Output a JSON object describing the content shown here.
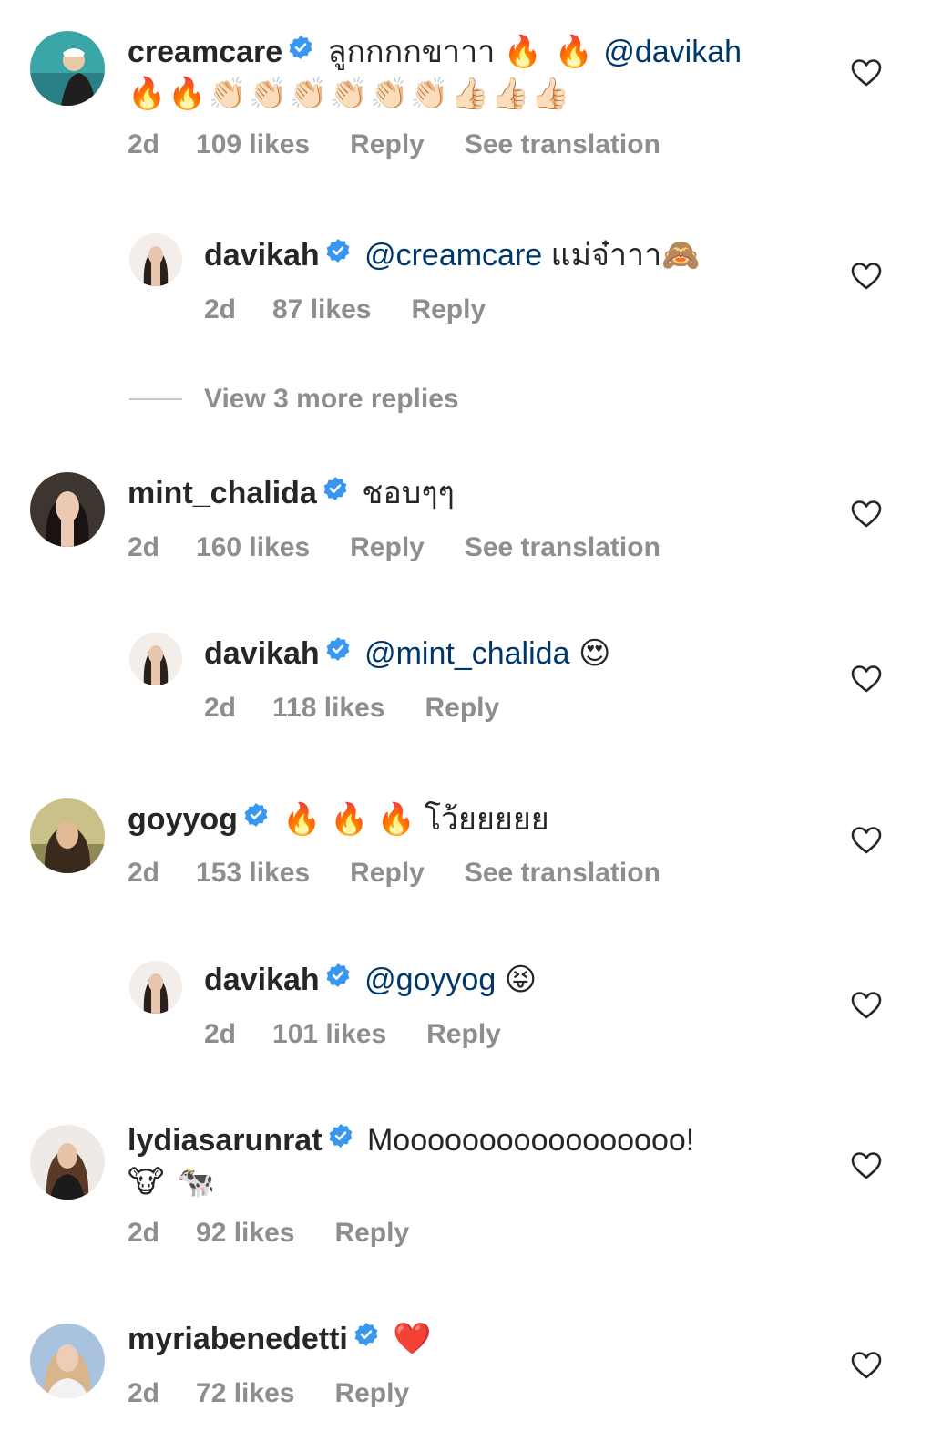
{
  "icons": {
    "verified": "verified-badge-icon",
    "like": "heart-outline-icon"
  },
  "colors": {
    "text": "#262626",
    "meta": "#8e8e8e",
    "mention": "#00376b",
    "verified": "#3897f0"
  },
  "comments": [
    {
      "username": "creamcare",
      "text": "ลูกกกกขาาา",
      "emoji_before": "🔥 🔥",
      "mention": "@davikah",
      "emoji_after": "🔥🔥👏🏻👏🏻👏🏻👏🏻👏🏻👏🏻👍🏻👍🏻👍🏻",
      "time": "2d",
      "likes": "109 likes",
      "reply": "Reply",
      "translate": "See translation"
    },
    {
      "username": "davikah",
      "mention": "@creamcare",
      "text": "แม่จ๋าาา🙈",
      "time": "2d",
      "likes": "87 likes",
      "reply": "Reply"
    },
    {
      "view_more": "View 3 more replies"
    },
    {
      "username": "mint_chalida",
      "text": "ชอบๆๆ",
      "time": "2d",
      "likes": "160 likes",
      "reply": "Reply",
      "translate": "See translation"
    },
    {
      "username": "davikah",
      "mention": "@mint_chalida",
      "text": "😍",
      "time": "2d",
      "likes": "118 likes",
      "reply": "Reply"
    },
    {
      "username": "goyyog",
      "text": "🔥 🔥 🔥  โว้ยยยยย",
      "time": "2d",
      "likes": "153 likes",
      "reply": "Reply",
      "translate": "See translation"
    },
    {
      "username": "davikah",
      "mention": "@goyyog",
      "text": "😝",
      "time": "2d",
      "likes": "101 likes",
      "reply": "Reply"
    },
    {
      "username": "lydiasarunrat",
      "text": "Mooooooooooooooooo!",
      "text_line2": "🐮 🐄",
      "time": "2d",
      "likes": "92 likes",
      "reply": "Reply"
    },
    {
      "username": "myriabenedetti",
      "text": "❤️",
      "time": "2d",
      "likes": "72 likes",
      "reply": "Reply"
    }
  ]
}
